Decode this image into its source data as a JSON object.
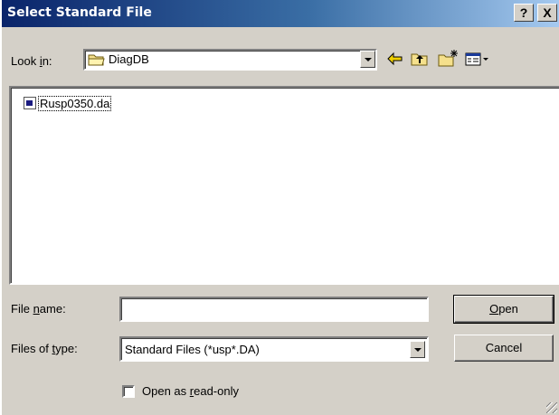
{
  "window": {
    "title": "Select Standard File",
    "help_glyph": "?",
    "close_glyph": "X"
  },
  "look_in": {
    "label_pre": "Look ",
    "label_u": "i",
    "label_post": "n:",
    "value": "DiagDB"
  },
  "file_list": {
    "items": [
      {
        "name": "Rusp0350.da"
      }
    ]
  },
  "file_name": {
    "label_pre": "File ",
    "label_u": "n",
    "label_post": "ame:",
    "value": ""
  },
  "files_of_type": {
    "label_pre": "Files of ",
    "label_u": "t",
    "label_post": "ype:",
    "value": "Standard Files (*usp*.DA)"
  },
  "buttons": {
    "open_u": "O",
    "open_rest": "pen",
    "cancel": "Cancel"
  },
  "readonly": {
    "label_pre": "Open as ",
    "label_u": "r",
    "label_post": "ead-only",
    "checked": false
  },
  "colors": {
    "title_gradient_start": "#0a246a",
    "title_gradient_end": "#a6caf0",
    "face": "#d4d0c8"
  }
}
